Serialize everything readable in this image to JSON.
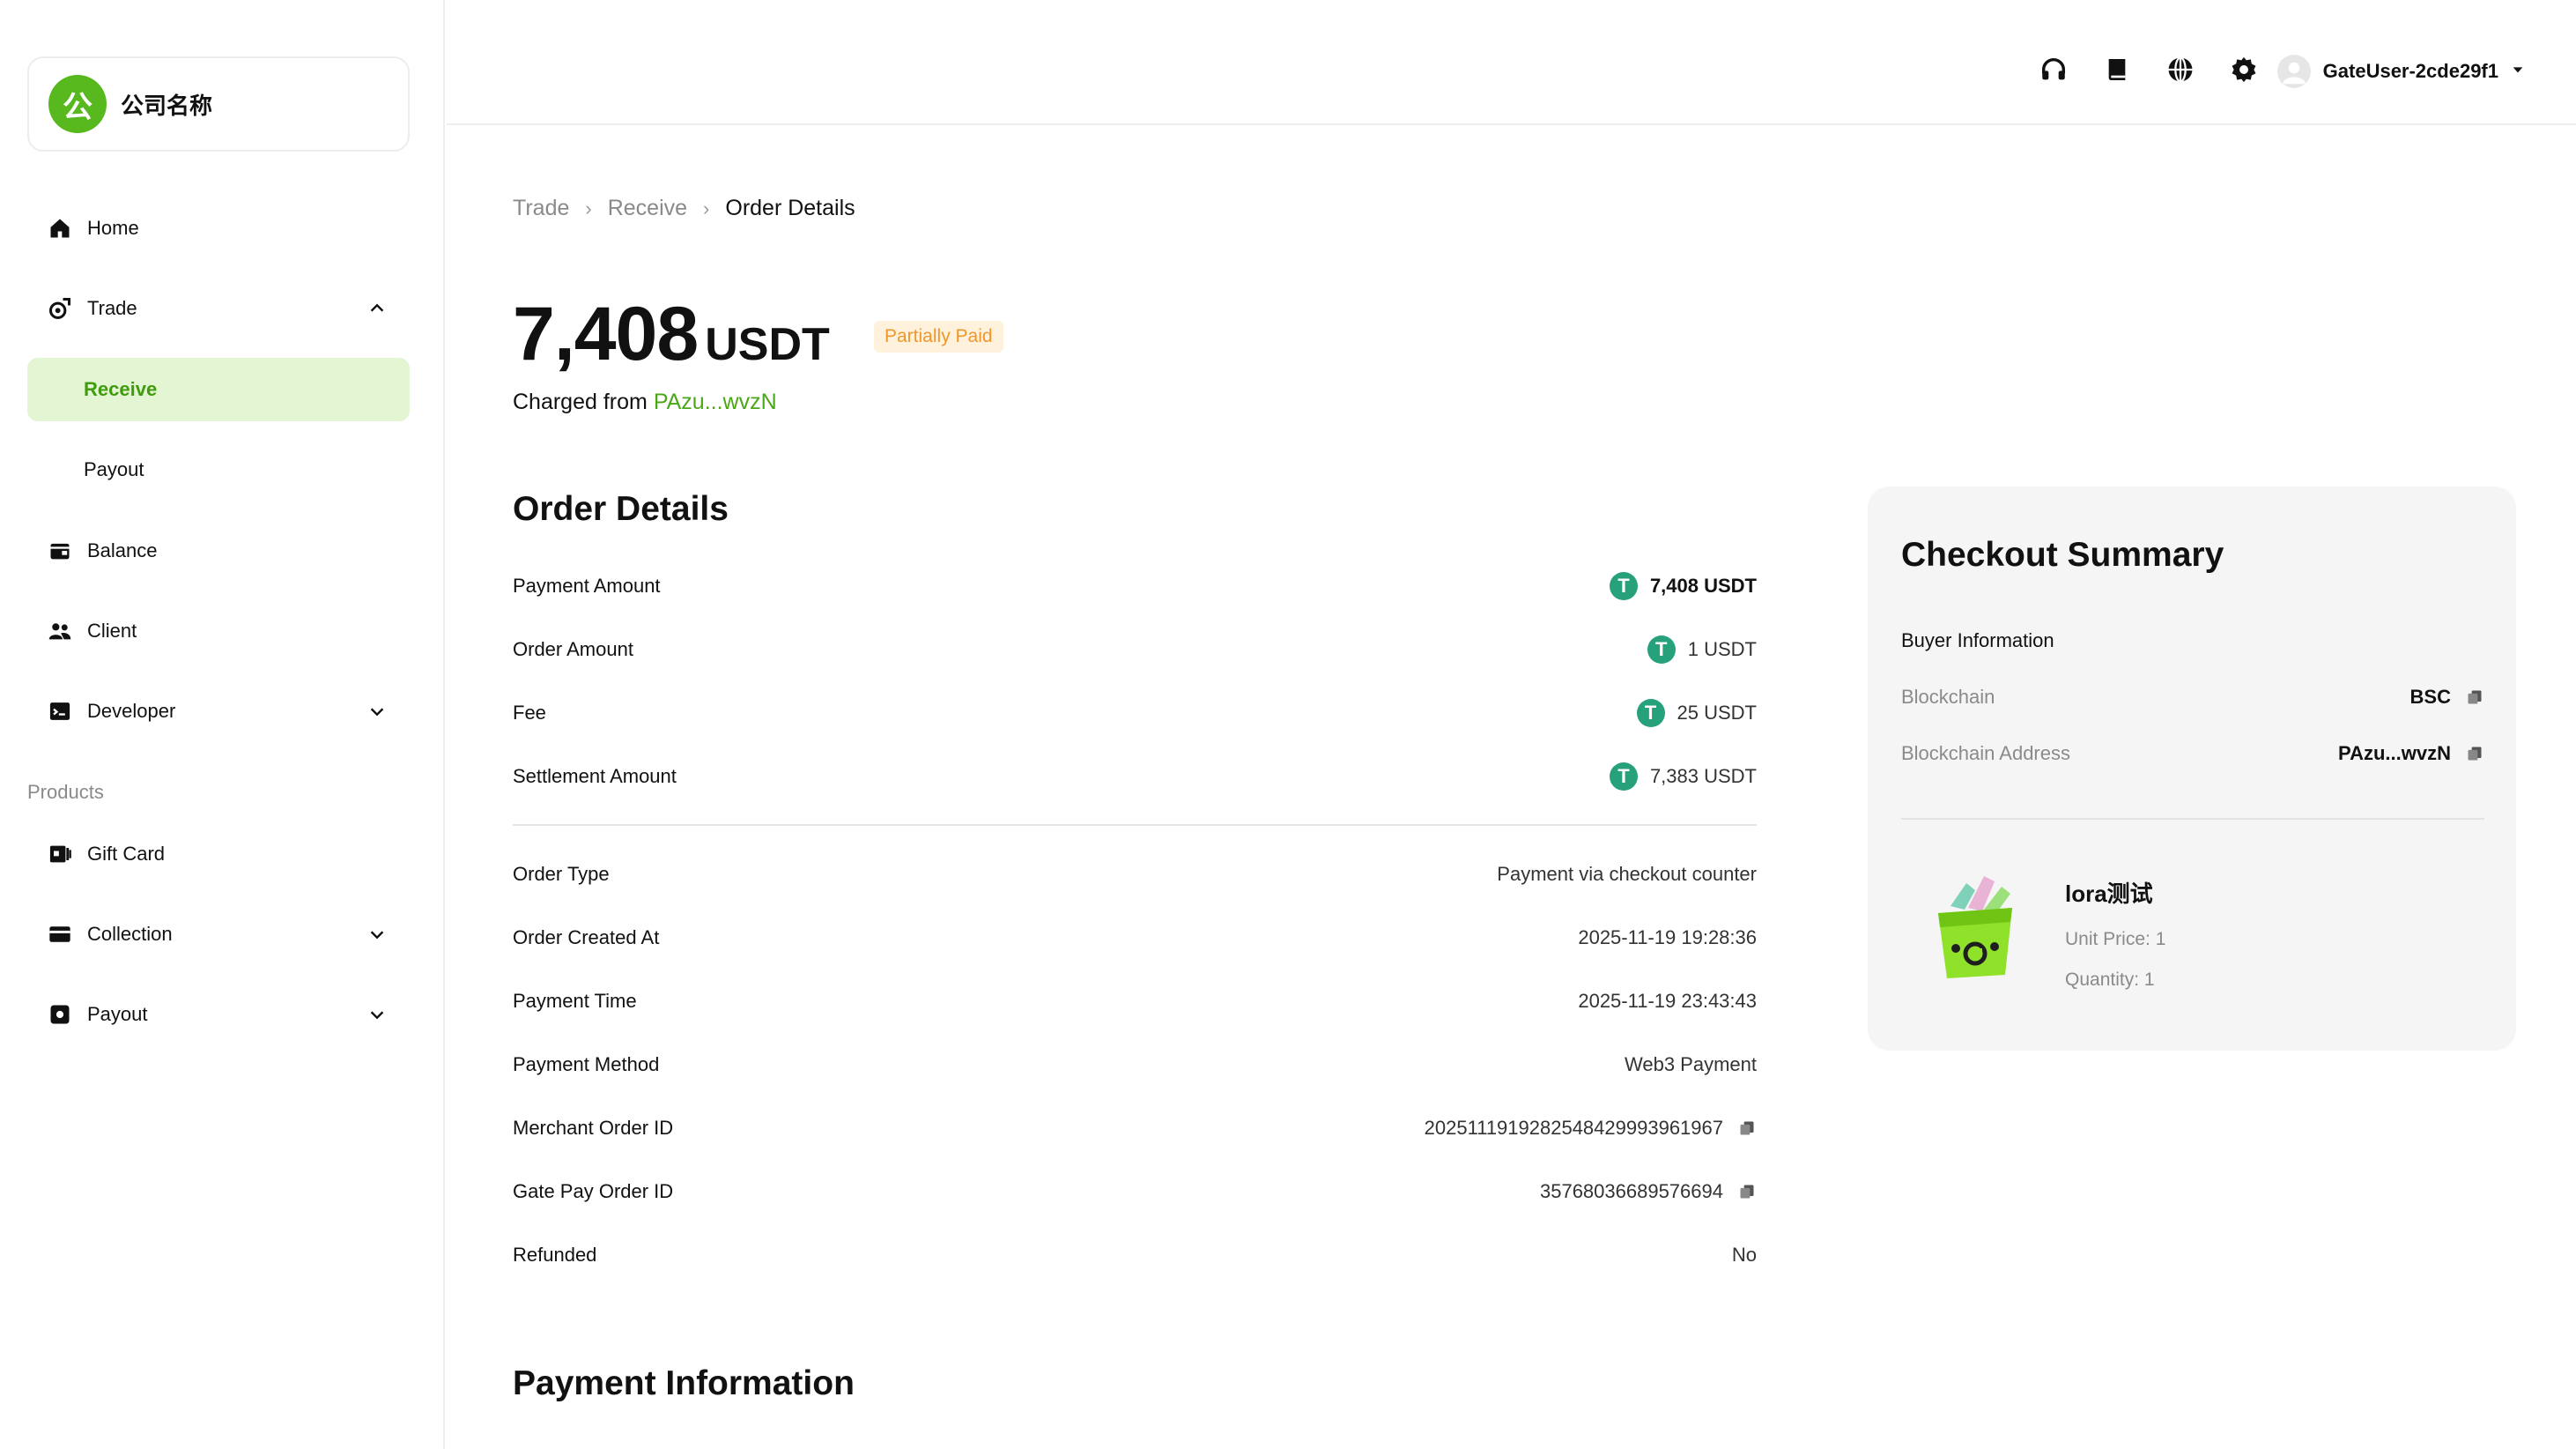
{
  "company": {
    "logo_char": "公",
    "name": "公司名称"
  },
  "sidebar": {
    "items": [
      {
        "label": "Home"
      },
      {
        "label": "Trade"
      },
      {
        "label": "Receive"
      },
      {
        "label": "Payout"
      },
      {
        "label": "Balance"
      },
      {
        "label": "Client"
      },
      {
        "label": "Developer"
      }
    ],
    "products_label": "Products",
    "product_items": [
      {
        "label": "Gift Card"
      },
      {
        "label": "Collection"
      },
      {
        "label": "Payout"
      }
    ]
  },
  "topbar": {
    "icons": [
      "headset-icon",
      "book-icon",
      "globe-icon",
      "settings-icon"
    ],
    "username": "GateUser-2cde29f1"
  },
  "breadcrumb": [
    "Trade",
    "Receive",
    "Order Details"
  ],
  "header": {
    "amount": "7,408",
    "unit": "USDT",
    "status": "Partially Paid",
    "charged_prefix": "Charged from",
    "charged_address": "PAzu...wvzN"
  },
  "order_details": {
    "title": "Order Details",
    "amounts": [
      {
        "label": "Payment Amount",
        "value": "7,408 USDT"
      },
      {
        "label": "Order Amount",
        "value": "1 USDT"
      },
      {
        "label": "Fee",
        "value": "25 USDT"
      },
      {
        "label": "Settlement Amount",
        "value": "7,383 USDT"
      }
    ],
    "info": [
      {
        "label": "Order Type",
        "value": "Payment via checkout counter"
      },
      {
        "label": "Order Created At",
        "value": "2025-11-19 19:28:36"
      },
      {
        "label": "Payment Time",
        "value": "2025-11-19 23:43:43"
      },
      {
        "label": "Payment Method",
        "value": "Web3 Payment"
      },
      {
        "label": "Merchant Order ID",
        "value": "202511191928254842999396196​7"
      },
      {
        "label": "Gate Pay Order ID",
        "value": "357680366895766​94"
      },
      {
        "label": "Refunded",
        "value": "No"
      }
    ]
  },
  "payment_information": {
    "title": "Payment Information"
  },
  "checkout_summary": {
    "title": "Checkout Summary",
    "buyer_label": "Buyer Information",
    "blockchain_label": "Blockchain",
    "blockchain_value": "BSC",
    "address_label": "Blockchain Address",
    "address_value": "PAzu...wvzN",
    "product": {
      "name": "lora测试",
      "unit_price": "Unit Price: 1",
      "quantity": "Quantity: 1"
    }
  },
  "colors": {
    "brand_green": "#58b91f",
    "active_bg": "#e4f5d3",
    "active_text": "#3f9c0c",
    "tether": "#26a17b",
    "badge_bg": "#fff2dd",
    "badge_text": "#f0962a"
  }
}
